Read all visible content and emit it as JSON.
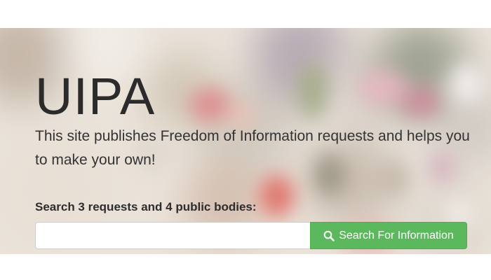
{
  "hero": {
    "title": "UIPA",
    "tagline": "This site publishes Freedom of Information requests and helps you to make your own!"
  },
  "search": {
    "label": "Search 3 requests and 4 public bodies:",
    "input_value": "",
    "placeholder": "",
    "button_label": "Search For Information",
    "button_icon": "search-icon"
  },
  "colors": {
    "button_green": "#5cb85c",
    "title_text": "#2b2b2b"
  }
}
